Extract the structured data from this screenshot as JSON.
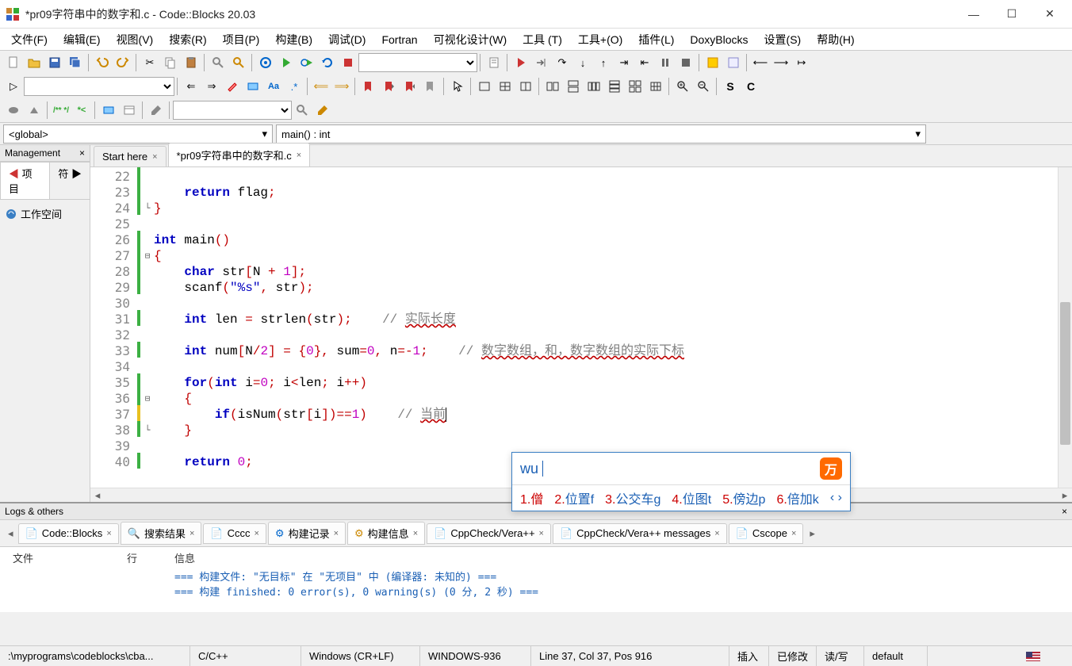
{
  "title": "*pr09字符串中的数字和.c - Code::Blocks 20.03",
  "menu": [
    "文件(F)",
    "编辑(E)",
    "视图(V)",
    "搜索(R)",
    "项目(P)",
    "构建(B)",
    "调试(D)",
    "Fortran",
    "可视化设计(W)",
    "工具 (T)",
    "工具+(O)",
    "插件(L)",
    "DoxyBlocks",
    "设置(S)",
    "帮助(H)"
  ],
  "scope": {
    "global": "<global>",
    "func": "main() : int"
  },
  "mgmt": {
    "title": "Management",
    "tabs": [
      "项目",
      "符"
    ],
    "workspace": "工作空间"
  },
  "editor_tabs": [
    {
      "label": "Start here",
      "active": false
    },
    {
      "label": "*pr09字符串中的数字和.c",
      "active": true
    }
  ],
  "lines": [
    22,
    23,
    24,
    25,
    26,
    27,
    28,
    29,
    30,
    31,
    32,
    33,
    34,
    35,
    36,
    37,
    38,
    39,
    40
  ],
  "code": {
    "l23_return": "return",
    "l23_flag": " flag",
    "l23_semi": ";",
    "l26_int": "int",
    "l26_main": " main",
    "l26_paren": "()",
    "l27_brace": "{",
    "l28_char": "char",
    "l28_rest": " str",
    "l28_b1": "[",
    "l28_N": "N ",
    "l28_plus": "+ ",
    "l28_one": "1",
    "l28_b2": "];",
    "l29_scanf": "scanf",
    "l29_p1": "(",
    "l29_fmt": "\"%s\"",
    "l29_comma": ", ",
    "l29_str": "str",
    "l29_p2": ");",
    "l31_int": "int",
    "l31_rest": " len ",
    "l31_eq": "= ",
    "l31_strlen": "strlen",
    "l31_p1": "(",
    "l31_arg": "str",
    "l31_p2": ");",
    "l31_cm": "// ",
    "l31_cmtxt": "实际长度",
    "l33_int": "int",
    "l33_num": " num",
    "l33_b1": "[",
    "l33_N": "N",
    "l33_div": "/",
    "l33_two": "2",
    "l33_b2": "] ",
    "l33_eq": "= {",
    "l33_zero": "0",
    "l33_rb": "}, ",
    "l33_sum": "sum",
    "l33_eq2": "=",
    "l33_z2": "0",
    "l33_c2": ", ",
    "l33_n": "n",
    "l33_eq3": "=-",
    "l33_one": "1",
    "l33_semi": ";",
    "l33_cm": "// ",
    "l33_cmtxt": "数字数组，和，数字数组的实际下标",
    "l35_for": "for",
    "l35_p1": "(",
    "l35_int": "int",
    "l35_i": " i",
    "l35_eq": "=",
    "l35_z": "0",
    "l35_s1": "; ",
    "l35_cond": "i",
    "l35_lt": "<",
    "l35_len": "len",
    "l35_s2": "; ",
    "l35_inc": "i",
    "l35_pp": "++)",
    "l36_brace": "{",
    "l37_if": "if",
    "l37_p1": "(",
    "l37_isnum": "isNum",
    "l37_p2": "(",
    "l37_str": "str",
    "l37_b1": "[",
    "l37_i": "i",
    "l37_b2": "])",
    "l37_eq": "==",
    "l37_one": "1",
    "l37_p3": ")",
    "l37_cm": "// ",
    "l37_cmtxt": "当前",
    "l38_brace": "}",
    "l40_return": "return",
    "l40_sp": " ",
    "l40_zero": "0",
    "l40_semi": ";"
  },
  "ime": {
    "input": "wu",
    "candidates": [
      {
        "idx": "1.",
        "txt": "僧"
      },
      {
        "idx": "2.",
        "txt": "位置f"
      },
      {
        "idx": "3.",
        "txt": "公交车g"
      },
      {
        "idx": "4.",
        "txt": "位图t"
      },
      {
        "idx": "5.",
        "txt": "傍边p"
      },
      {
        "idx": "6.",
        "txt": "倍加k"
      }
    ]
  },
  "logs": {
    "title": "Logs & others",
    "tabs": [
      "Code::Blocks",
      "搜索结果",
      "Cccc",
      "构建记录",
      "构建信息",
      "CppCheck/Vera++",
      "CppCheck/Vera++ messages",
      "Cscope"
    ],
    "active_tab": 4,
    "hdr": {
      "c1": "文件",
      "c2": "行",
      "c3": "信息"
    },
    "msgs": [
      "=== 构建文件: \"无目标\" 在 \"无项目\" 中 (编译器: 未知的) ===",
      "=== 构建 finished: 0 error(s), 0 warning(s) (0 分, 2 秒) ==="
    ]
  },
  "status": {
    "path": ":\\myprograms\\codeblocks\\cba...",
    "lang": "C/C++",
    "eol": "Windows (CR+LF)",
    "enc": "WINDOWS-936",
    "pos": "Line 37, Col 37, Pos 916",
    "ins": "插入",
    "mod": "已修改",
    "rw": "读/写",
    "prof": "default"
  }
}
